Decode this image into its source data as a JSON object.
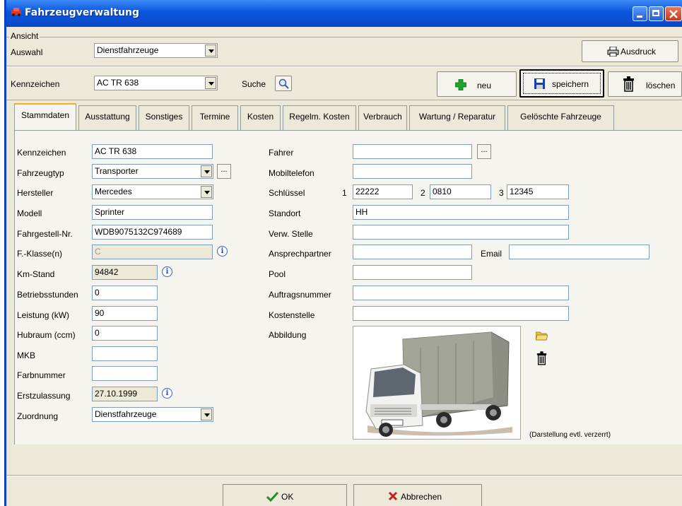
{
  "window": {
    "title": "Fahrzeugverwaltung"
  },
  "ansicht": {
    "group_label": "Ansicht",
    "auswahl_label": "Auswahl",
    "auswahl_value": "Dienstfahrzeuge",
    "print_button": "Ausdruck"
  },
  "toolbar": {
    "kennzeichen_label": "Kennzeichen",
    "kennzeichen_value": "AC TR 638",
    "search_label": "Suche",
    "new_label": "neu",
    "save_label": "speichern",
    "delete_label": "löschen"
  },
  "tabs": [
    {
      "label": "Stammdaten"
    },
    {
      "label": "Ausstattung"
    },
    {
      "label": "Sonstiges"
    },
    {
      "label": "Termine"
    },
    {
      "label": "Kosten"
    },
    {
      "label": "Regelm. Kosten"
    },
    {
      "label": "Verbrauch"
    },
    {
      "label": "Wartung / Reparatur"
    },
    {
      "label": "Gelöschte Fahrzeuge"
    }
  ],
  "left": {
    "kennzeichen": {
      "label": "Kennzeichen",
      "value": "AC TR 638"
    },
    "fahrzeugtyp": {
      "label": "Fahrzeugtyp",
      "value": "Transporter"
    },
    "hersteller": {
      "label": "Hersteller",
      "value": "Mercedes"
    },
    "modell": {
      "label": "Modell",
      "value": "Sprinter"
    },
    "fahrgestell": {
      "label": "Fahrgestell-Nr.",
      "value": "WDB9075132C974689"
    },
    "fklasse": {
      "label": "F.-Klasse(n)",
      "value": "C"
    },
    "kmstand": {
      "label": "Km-Stand",
      "value": "94842"
    },
    "betriebsstunden": {
      "label": "Betriebsstunden",
      "value": "0"
    },
    "leistung": {
      "label": "Leistung (kW)",
      "value": "90"
    },
    "hubraum": {
      "label": "Hubraum (ccm)",
      "value": "0"
    },
    "mkb": {
      "label": "MKB",
      "value": ""
    },
    "farbnummer": {
      "label": "Farbnummer",
      "value": ""
    },
    "erstzulassung": {
      "label": "Erstzulassung",
      "value": "27.10.1999"
    },
    "zuordnung": {
      "label": "Zuordnung",
      "value": "Dienstfahrzeuge"
    }
  },
  "right": {
    "fahrer": {
      "label": "Fahrer",
      "value": ""
    },
    "mobiltelefon": {
      "label": "Mobiltelefon",
      "value": ""
    },
    "schluessel": {
      "label": "Schlüssel",
      "n1": "1",
      "v1": "22222",
      "n2": "2",
      "v2": "0810",
      "n3": "3",
      "v3": "12345"
    },
    "standort": {
      "label": "Standort",
      "value": "HH"
    },
    "verwstelle": {
      "label": "Verw. Stelle",
      "value": ""
    },
    "ansprechpartner": {
      "label": "Ansprechpartner",
      "value": ""
    },
    "email": {
      "label": "Email",
      "value": ""
    },
    "pool": {
      "label": "Pool",
      "value": ""
    },
    "auftragsnummer": {
      "label": "Auftragsnummer",
      "value": ""
    },
    "kostenstelle": {
      "label": "Kostenstelle",
      "value": ""
    },
    "abbildung": {
      "label": "Abbildung",
      "note": "(Darstellung evtl. verzerrt)"
    }
  },
  "footer": {
    "ok_label": "OK",
    "cancel_label": "Abbrechen"
  },
  "ellipsis": "...",
  "colors": {
    "title_bar": "#0855dd",
    "tab_accent": "#f1b31c",
    "dialog_bg": "#ece9d8",
    "panel_bg": "#f5f4ee"
  }
}
